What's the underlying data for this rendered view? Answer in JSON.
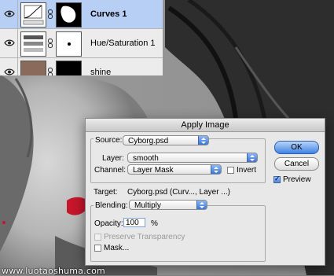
{
  "layers_panel": {
    "layers": [
      {
        "name": "Curves 1",
        "selected": true,
        "thumb": "curves-adjustment-icon"
      },
      {
        "name": "Hue/Saturation 1",
        "selected": false,
        "thumb": "hue-saturation-adjustment-icon"
      },
      {
        "name": "shine",
        "selected": false,
        "thumb": "photo-thumbnail"
      }
    ]
  },
  "dialog": {
    "title": "Apply Image",
    "source_label": "Source:",
    "source_value": "Cyborg.psd",
    "layer_label": "Layer:",
    "layer_value": "smooth",
    "channel_label": "Channel:",
    "channel_value": "Layer Mask",
    "invert_label": "Invert",
    "target_label": "Target:",
    "target_value": "Cyborg.psd (Curv..., Layer ...)",
    "blending_label": "Blending:",
    "blending_value": "Multiply",
    "opacity_label": "Opacity:",
    "opacity_value": "100",
    "opacity_unit": "%",
    "preserve_transparency_label": "Preserve Transparency",
    "mask_label": "Mask...",
    "ok_label": "OK",
    "cancel_label": "Cancel",
    "preview_label": "Preview",
    "invert_checked": false,
    "preview_checked": true,
    "mask_checked": false
  },
  "watermark": "www.luotaoshuma.com",
  "colors": {
    "accent": "#3f83e4",
    "lips": "#c5162a",
    "selected_layer": "#b8cff5"
  }
}
